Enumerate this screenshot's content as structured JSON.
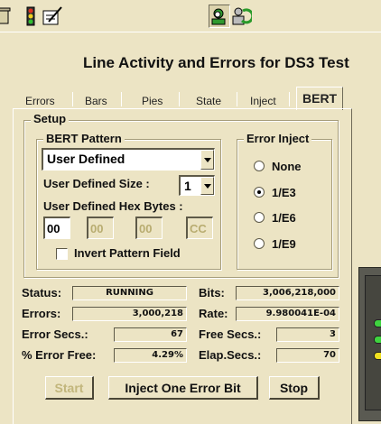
{
  "title": "Line Activity and Errors for DS3 Test",
  "toolbar": {
    "icons": [
      "trash-icon",
      "traffic-light-icon",
      "edit-notes-icon",
      "search-user-icon",
      "refresh-person-icon"
    ]
  },
  "tabs": [
    {
      "label": "Errors",
      "active": false
    },
    {
      "label": "Bars",
      "active": false
    },
    {
      "label": "Pies",
      "active": false
    },
    {
      "label": "State",
      "active": false
    },
    {
      "label": "Inject",
      "active": false
    },
    {
      "label": "BERT",
      "active": true
    }
  ],
  "setup": {
    "group_label": "Setup",
    "bert_pattern": {
      "group_label": "BERT Pattern",
      "selected": "User Defined"
    },
    "user_defined_size": {
      "label": "User Defined Size :",
      "value": "1"
    },
    "hex_bytes": {
      "label": "User Defined Hex Bytes :",
      "values": [
        "00",
        "00",
        "00",
        "CC"
      ]
    },
    "invert_pattern": {
      "label": "Invert Pattern Field",
      "checked": false
    },
    "error_inject": {
      "group_label": "Error Inject",
      "options": [
        "None",
        "1/E3",
        "1/E6",
        "1/E9"
      ],
      "selected": "1/E3"
    }
  },
  "stats": {
    "status": {
      "label": "Status:",
      "value": "RUNNING"
    },
    "errors": {
      "label": "Errors:",
      "value": "3,000,218"
    },
    "error_secs": {
      "label": "Error Secs.:",
      "value": "67"
    },
    "pct_error_free": {
      "label": "% Error Free:",
      "value": "4.29%"
    },
    "bits": {
      "label": "Bits:",
      "value": "3,006,218,000"
    },
    "rate": {
      "label": "Rate:",
      "value": "9.980041E-04"
    },
    "free_secs": {
      "label": "Free Secs.:",
      "value": "3"
    },
    "elap_secs": {
      "label": "Elap.Secs.:",
      "value": "70"
    }
  },
  "buttons": {
    "start": "Start",
    "inject_one": "Inject One Error Bit",
    "stop": "Stop"
  },
  "colors": {
    "background": "#ece4c4",
    "led_green": "#3fd43f",
    "led_yellow": "#f0e020"
  }
}
